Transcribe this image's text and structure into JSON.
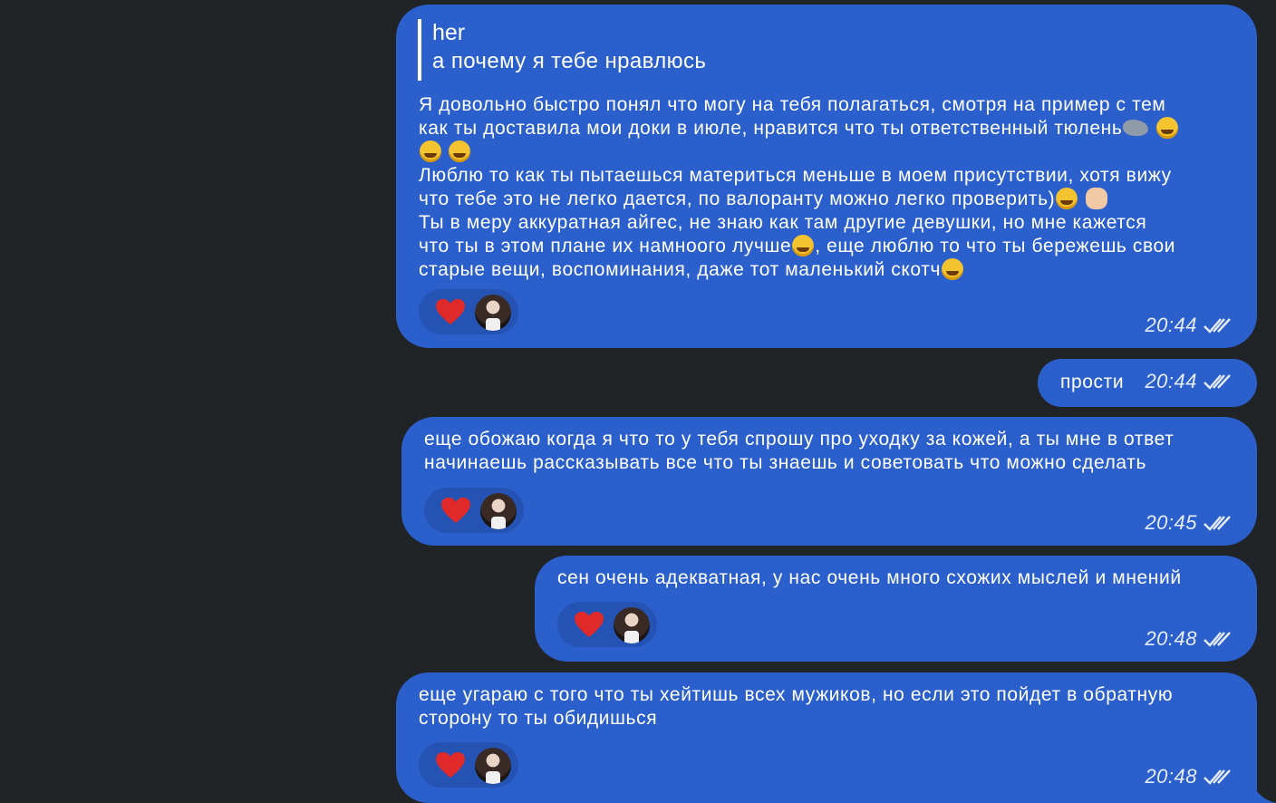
{
  "colors": {
    "background": "#212426",
    "bubble": "#2B5FCB",
    "reaction_pill": "#2453B4",
    "heart": "#E02A2A",
    "text": "#FFFFFF"
  },
  "messages": [
    {
      "reply": {
        "author": "her",
        "quote": "а почему я тебе нравлюсь"
      },
      "lines": [
        "Я довольно быстро понял что могу на тебя полагаться, смотря на пример с тем",
        "как ты доставила мои доки в июле, нравится что ты ответственный тюлень",
        "Люблю то как ты пытаешься материться меньше в моем присутствии, хотя вижу",
        "что тебе это не легко дается, по валоранту можно легко проверить)",
        "Ты в меру аккуратная айгес, не знаю как там другие девушки, но мне кажется",
        "что ты в этом плане их намноого лучше",
        ", еще люблю то что ты бережешь свои",
        "старые вещи, воспоминания, даже тот маленький скотч"
      ],
      "reactions": {
        "emoji": "heart-icon",
        "has_avatar": true
      },
      "time": "20:44",
      "status": "read"
    },
    {
      "text": "прости",
      "time": "20:44",
      "status": "read"
    },
    {
      "text": "еще обожаю когда я что то у тебя спрошу про уходку за кожей, а ты мне в ответ\nначинаешь рассказывать все что ты знаешь и советовать что можно сделать",
      "reactions": {
        "emoji": "heart-icon",
        "has_avatar": true
      },
      "time": "20:45",
      "status": "read"
    },
    {
      "text": "сен очень адекватная, у нас очень много схожих мыслей и мнений",
      "reactions": {
        "emoji": "heart-icon",
        "has_avatar": true
      },
      "time": "20:48",
      "status": "read"
    },
    {
      "text": "еще угараю с того что ты хейтишь всех мужиков, но если это пойдет в обратную\nсторону то ты обидишься",
      "reactions": {
        "emoji": "heart-icon",
        "has_avatar": true
      },
      "time": "20:48",
      "status": "read"
    }
  ]
}
